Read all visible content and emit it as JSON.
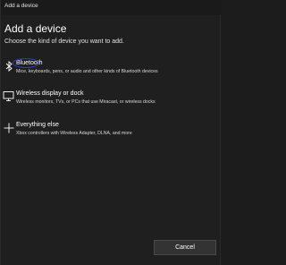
{
  "window": {
    "title": "Add a device"
  },
  "header": {
    "title": "Add a device",
    "subtitle": "Choose the kind of device you want to add."
  },
  "options": [
    {
      "icon": "bluetooth-icon",
      "title": "Bluetooth",
      "description": "Mice, keyboards, pens, or audio and other kinds of Bluetooth devices"
    },
    {
      "icon": "monitor-icon",
      "title": "Wireless display or dock",
      "description": "Wireless monitors, TVs, or PCs that use Miracast, or wireless docks"
    },
    {
      "icon": "plus-icon",
      "title": "Everything else",
      "description": "Xbox controllers with Wireless Adapter, DLNA, and more"
    }
  ],
  "footer": {
    "cancel_label": "Cancel"
  },
  "colors": {
    "background": "#1f1f1f",
    "annotation": "#2b3fbd",
    "button": "#333333"
  }
}
